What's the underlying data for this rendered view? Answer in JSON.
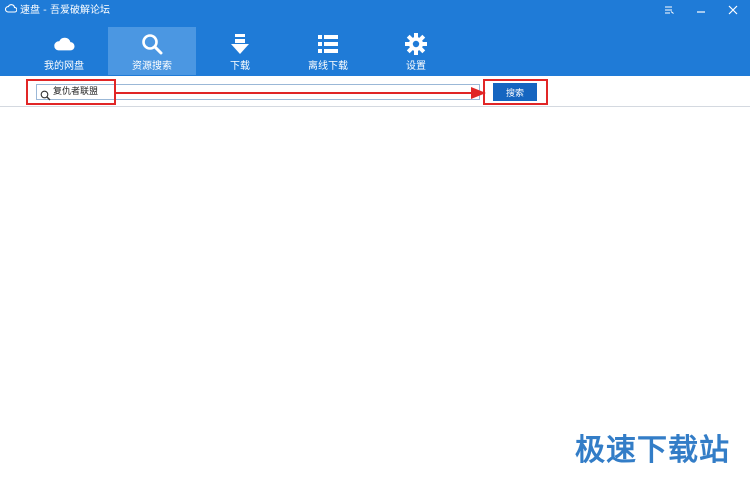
{
  "window": {
    "title": "速盘 - 吾爱破解论坛",
    "controls": [
      "menu-icon",
      "minimize-icon",
      "close-icon"
    ]
  },
  "nav": {
    "items": [
      {
        "label": "我的网盘",
        "icon": "cloud-icon",
        "active": false
      },
      {
        "label": "资源搜索",
        "icon": "search-icon",
        "active": true
      },
      {
        "label": "下载",
        "icon": "download-icon",
        "active": false
      },
      {
        "label": "离线下载",
        "icon": "list-icon",
        "active": false
      },
      {
        "label": "设置",
        "icon": "gear-icon",
        "active": false
      }
    ]
  },
  "search": {
    "value": "复仇者联盟",
    "button_label": "搜索"
  },
  "watermark": "极速下载站",
  "colors": {
    "header": "#1f7bd7",
    "active_tab": "#4b97e2",
    "button": "#1565c0",
    "annotation": "#e12626"
  }
}
